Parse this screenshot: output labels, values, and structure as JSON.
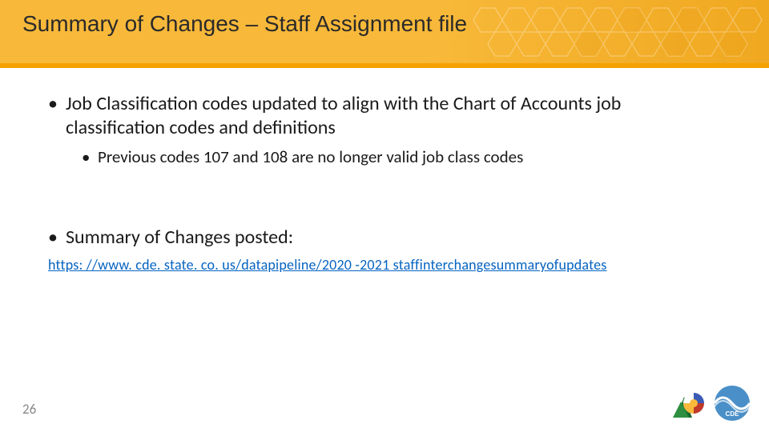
{
  "header": {
    "title": "Summary of Changes – Staff Assignment file"
  },
  "content": {
    "bullet1": "Job Classification codes updated to align with the Chart of Accounts job classification codes and definitions",
    "sub1": "Previous codes 107 and 108 are no longer valid job class codes",
    "bullet2": "Summary of Changes posted:",
    "link_text": "https: //www. cde. state. co. us/datapipeline/2020 -2021 staffinterchangesummaryofupdates"
  },
  "footer": {
    "page_number": "26"
  },
  "logos": {
    "colorado": "colorado-logo",
    "cde": "cde-logo"
  }
}
